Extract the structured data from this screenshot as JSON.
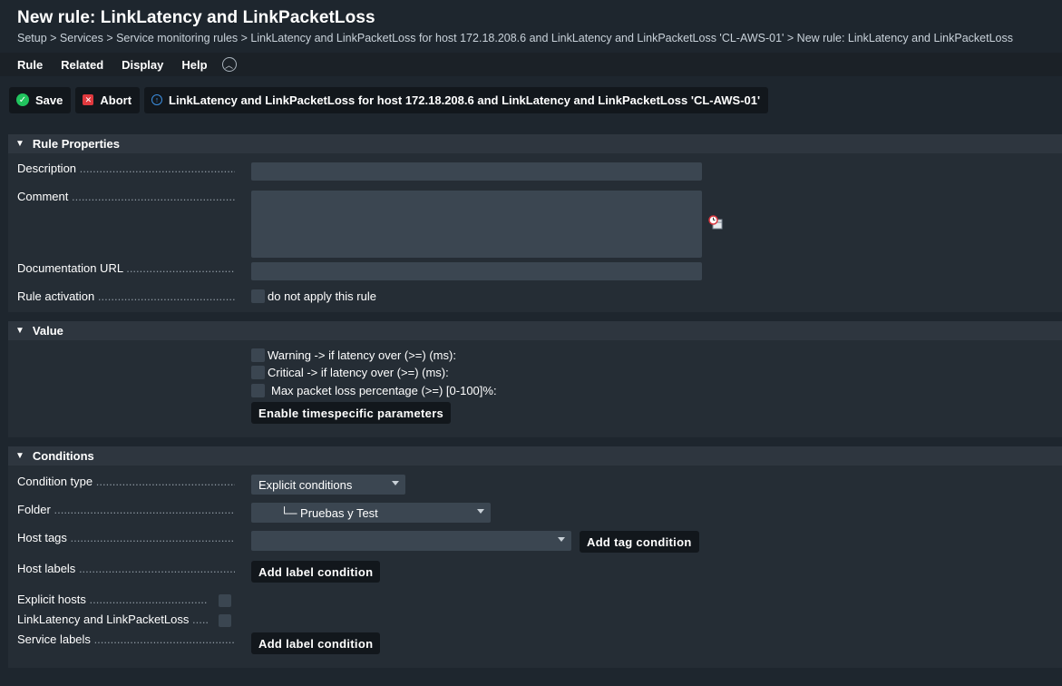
{
  "page": {
    "title": "New rule: LinkLatency and LinkPacketLoss",
    "breadcrumb": "Setup > Services > Service monitoring rules > LinkLatency and LinkPacketLoss for host 172.18.208.6 and LinkLatency and LinkPacketLoss 'CL-AWS-01' > New rule: LinkLatency and LinkPacketLoss"
  },
  "menu": {
    "rule": "Rule",
    "related": "Related",
    "display": "Display",
    "help": "Help"
  },
  "actions": {
    "save": "Save",
    "abort": "Abort",
    "context": "LinkLatency and LinkPacketLoss for host 172.18.208.6 and LinkLatency and LinkPacketLoss 'CL-AWS-01'"
  },
  "rule_properties": {
    "header": "Rule Properties",
    "description_label": "Description",
    "description_value": "",
    "comment_label": "Comment",
    "comment_value": "",
    "doc_url_label": "Documentation URL",
    "doc_url_value": "",
    "activation_label": "Rule activation",
    "activation_checkbox": "do not apply this rule"
  },
  "value": {
    "header": "Value",
    "warning": "Warning -> if latency over (>=) (ms):",
    "critical": "Critical -> if latency over (>=) (ms):",
    "packet_loss": "Max packet loss percentage (>=) [0-100]%:",
    "timespecific_button": "Enable timespecific parameters"
  },
  "conditions": {
    "header": "Conditions",
    "condition_type_label": "Condition type",
    "condition_type_value": "Explicit conditions",
    "folder_label": "Folder",
    "folder_value": "└─ Pruebas y Test",
    "host_tags_label": "Host tags",
    "host_tags_value": "",
    "add_tag_condition": "Add tag condition",
    "host_labels_label": "Host labels",
    "add_label_condition": "Add label condition",
    "explicit_hosts_label": "Explicit hosts",
    "service_label": "LinkLatency and LinkPacketLoss",
    "service_labels_label": "Service labels",
    "add_service_label_condition": "Add label condition"
  },
  "colors": {
    "background": "#1e262e",
    "panel": "#252d35",
    "header": "#2e363f",
    "field": "#3b4651",
    "button": "#12171c",
    "save_icon": "#21c45e",
    "abort_icon": "#e0393e",
    "info_icon": "#3c8fe0"
  },
  "icons": {
    "save": "check-circle-icon",
    "abort": "close-square-icon",
    "context": "info-icon",
    "menu_toggle": "chevron-up-icon",
    "comment_stamp": "clock-calendar-icon"
  }
}
